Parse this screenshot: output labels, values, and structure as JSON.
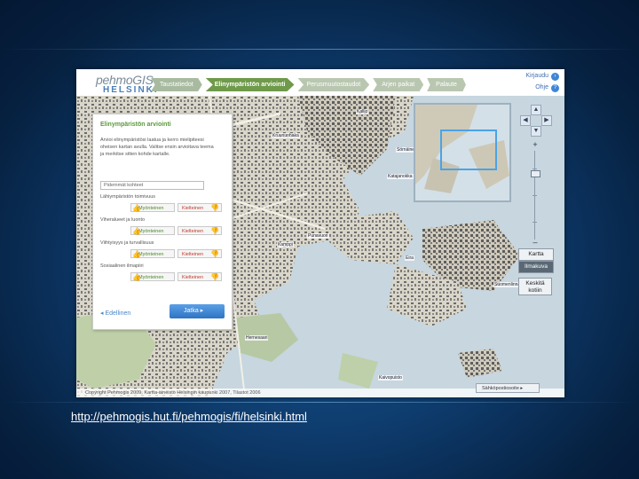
{
  "app": {
    "logo_main": "pehmoGIS",
    "logo_city": "HELSINKI"
  },
  "nav": {
    "tabs": [
      {
        "label": "Taustatiedot",
        "active": false
      },
      {
        "label": "Elinympäristön arviointi",
        "active": true
      },
      {
        "label": "Perusmuutostaudot",
        "active": false
      },
      {
        "label": "Arjen paikat",
        "active": false
      },
      {
        "label": "Palaute",
        "active": false
      }
    ],
    "links": [
      "Kirjaudu",
      "Ohje"
    ]
  },
  "panel": {
    "title": "Elinympäristön arviointi",
    "intro": "Arvioi elinympäristösi laatua ja kerro mielipiteesi oheisen kartan avulla. Valitse ensin arvioitava teema ja merkitse sitten kohde kartalle.",
    "field_value": "Pidemmät kohteet",
    "questions": [
      {
        "label": "Lähiympäristön toimivuus",
        "yes": "Myönteinen",
        "no": "Kielteinen"
      },
      {
        "label": "Viheralueet ja luonto",
        "yes": "Myönteinen",
        "no": "Kielteinen"
      },
      {
        "label": "Viihtyisyys ja turvallisuus",
        "yes": "Myönteinen",
        "no": "Kielteinen"
      },
      {
        "label": "Sosiaalinen ilmapiiri",
        "yes": "Myönteinen",
        "no": "Kielteinen"
      }
    ],
    "back_label": "Edellinen",
    "next_label": "Jatka"
  },
  "map": {
    "buttons": {
      "map": "Kartta",
      "aerial": "Ilmakuva",
      "reset": "Keskitä kotiin"
    },
    "print_label": "Sähköpostiosoite",
    "copyright": "Copyright Pehmogis 2009, Kartta-aineisto Helsingin kaupunki 2007, Tilastot 2006",
    "places": [
      "Kruununhaka",
      "Eira",
      "Sörnäinen",
      "Katajanokka",
      "Kaivopuisto",
      "Töölö",
      "Punavuori",
      "Kamppi",
      "Lauttasaari",
      "Suomenlinna",
      "Hernesaari",
      "Kallio"
    ]
  },
  "caption": "http://pehmogis.hut.fi/pehmogis/fi/helsinki.html",
  "colors": {
    "accent": "#6f9a4a",
    "button_blue": "#2f73c2",
    "background": "#0e3c6e"
  }
}
